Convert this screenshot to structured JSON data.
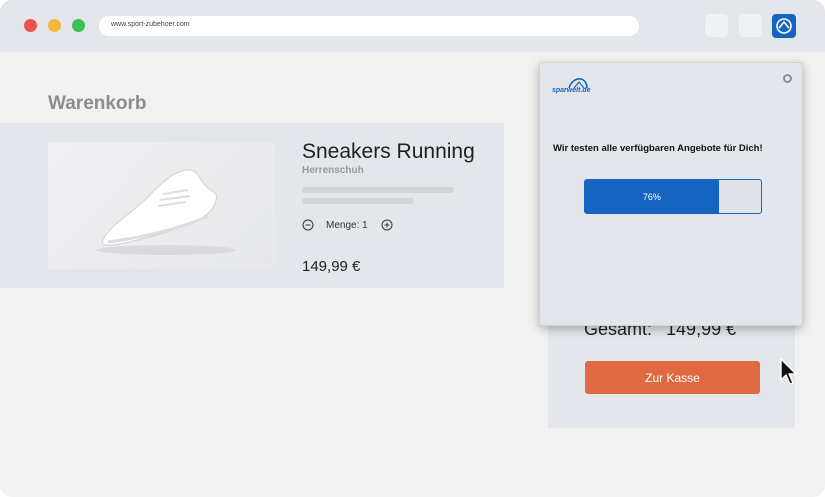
{
  "browser": {
    "url": "www.sport-zubehoer.com",
    "extension_icon": "sparwelt-logo-icon"
  },
  "page": {
    "title": "Warenkorb",
    "product": {
      "name": "Sneakers Running",
      "subtitle": "Herrenschuh",
      "quantity_label": "Menge: 1",
      "price": "149,99 €",
      "image": "sneaker-product-image"
    },
    "summary": {
      "total_label": "Gesamt:",
      "total_value": "149,99 €",
      "checkout_label": "Zur Kasse"
    }
  },
  "popup": {
    "brand": "sparwelt.de",
    "message": "Wir testen alle verfügbaren Angebote für Dich!",
    "progress_percent": 76,
    "progress_label": "76%"
  },
  "colors": {
    "brand_blue": "#1565c0",
    "checkout_orange": "#df6941",
    "chrome_gray": "#e3e6ea"
  }
}
